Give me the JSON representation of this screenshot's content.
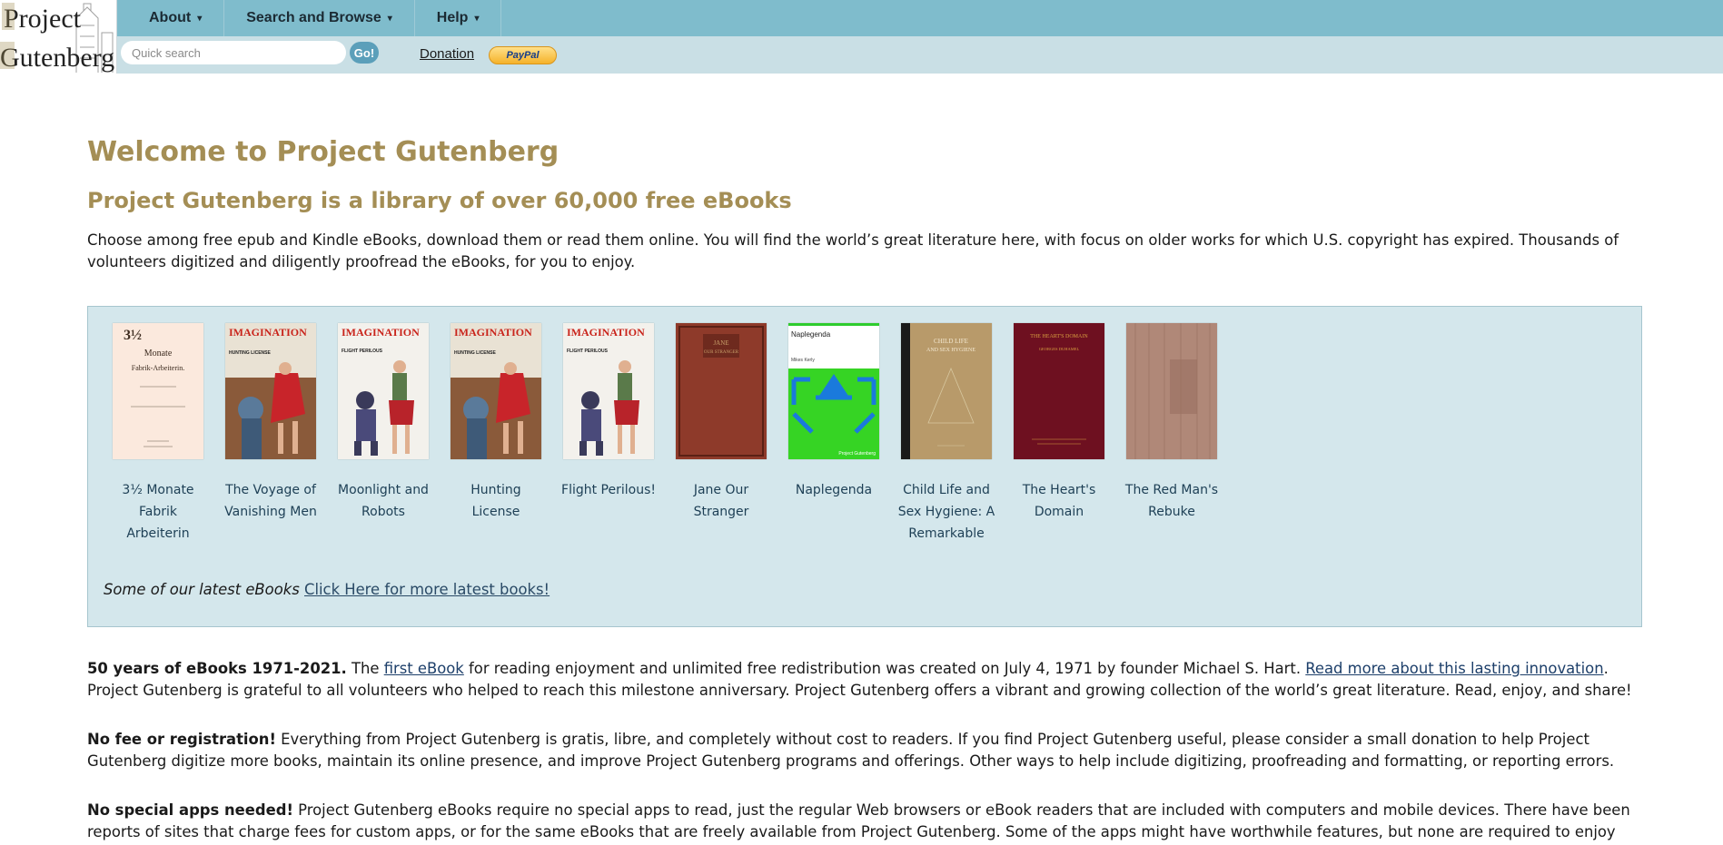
{
  "logo": {
    "line1": "Project",
    "line2": "Gutenberg"
  },
  "nav": {
    "menu": [
      {
        "label": "About"
      },
      {
        "label": "Search and Browse"
      },
      {
        "label": "Help"
      }
    ],
    "caret": "▾",
    "search_placeholder": "Quick search",
    "go_label": "Go!",
    "donation_label": "Donation",
    "paypal_label": "PayPal"
  },
  "main": {
    "title": "Welcome to Project Gutenberg",
    "subtitle": "Project Gutenberg is a library of over 60,000 free eBooks",
    "intro": "Choose among free epub and Kindle eBooks, download them or read them online. You will find the world’s great literature here, with focus on older works for which U.S. copyright has expired. Thousands of volunteers digitized and diligently proofread the eBooks, for you to enjoy.",
    "books": [
      {
        "title": "3½ Monate Fabrik Arbeiterin",
        "cover_text": [
          "3½",
          "Monate",
          "Fabrik-Arbeiterin."
        ]
      },
      {
        "title": "The Voyage of Vanishing Men",
        "cover_text": [
          "IMAGINATION",
          "HUNTING LICENSE"
        ]
      },
      {
        "title": "Moonlight and Robots",
        "cover_text": [
          "IMAGINATION",
          "FLIGHT PERILOUS"
        ]
      },
      {
        "title": "Hunting License",
        "cover_text": [
          "IMAGINATION",
          "HUNTING LICENSE"
        ]
      },
      {
        "title": "Flight Perilous!",
        "cover_text": [
          "IMAGINATION",
          "FLIGHT PERILOUS"
        ]
      },
      {
        "title": "Jane Our Stranger",
        "cover_text": [
          "JANE",
          "OUR STRANGER"
        ]
      },
      {
        "title": "Naplegenda",
        "cover_text": [
          "Naplegenda",
          "Mikes Kerly",
          "Project Gutenberg"
        ]
      },
      {
        "title": "Child Life and Sex Hygiene: A Remarkable",
        "cover_text": [
          "CHILD LIFE",
          "AND SEX HYGIENE"
        ]
      },
      {
        "title": "The Heart's Domain",
        "cover_text": [
          "THE HEART'S DOMAIN",
          "GEORGES DUHAMEL"
        ]
      },
      {
        "title": "The Red Man's Rebuke",
        "cover_text": []
      }
    ],
    "latest_caption": "Some of our latest eBooks",
    "latest_link": "Click Here for more latest books!",
    "para_50": {
      "bold": "50 years of eBooks 1971-2021.",
      "t1": " The ",
      "link1": "first eBook",
      "t2": " for reading enjoyment and unlimited free redistribution was created on July 4, 1971 by founder Michael S. Hart. ",
      "link2": "Read more about this lasting innovation",
      "t3": ". Project Gutenberg is grateful to all volunteers who helped to reach this milestone anniversary. Project Gutenberg offers a vibrant and growing collection of the world’s great literature. Read, enjoy, and share!"
    },
    "para_fee": {
      "bold": "No fee or registration!",
      "text": " Everything from Project Gutenberg is gratis, libre, and completely without cost to readers. If you find Project Gutenberg useful, please consider a small donation to help Project Gutenberg digitize more books, maintain its online presence, and improve Project Gutenberg programs and offerings. Other ways to help include digitizing, proofreading and formatting, or reporting errors."
    },
    "para_apps": {
      "bold": "No special apps needed!",
      "text": " Project Gutenberg eBooks require no special apps to read, just the regular Web browsers or eBook readers that are included with computers and mobile devices. There have been reports of sites that charge fees for custom apps, or for the same eBooks that are freely available from Project Gutenberg. Some of the apps might have worthwhile features, but none are required to enjoy Project Gutenberg eBooks."
    }
  },
  "colors": {
    "topbar": "#7fbccc",
    "subbar": "#c9dfe5",
    "heading": "#a48e55",
    "latest_box": "#d4e7ec"
  }
}
